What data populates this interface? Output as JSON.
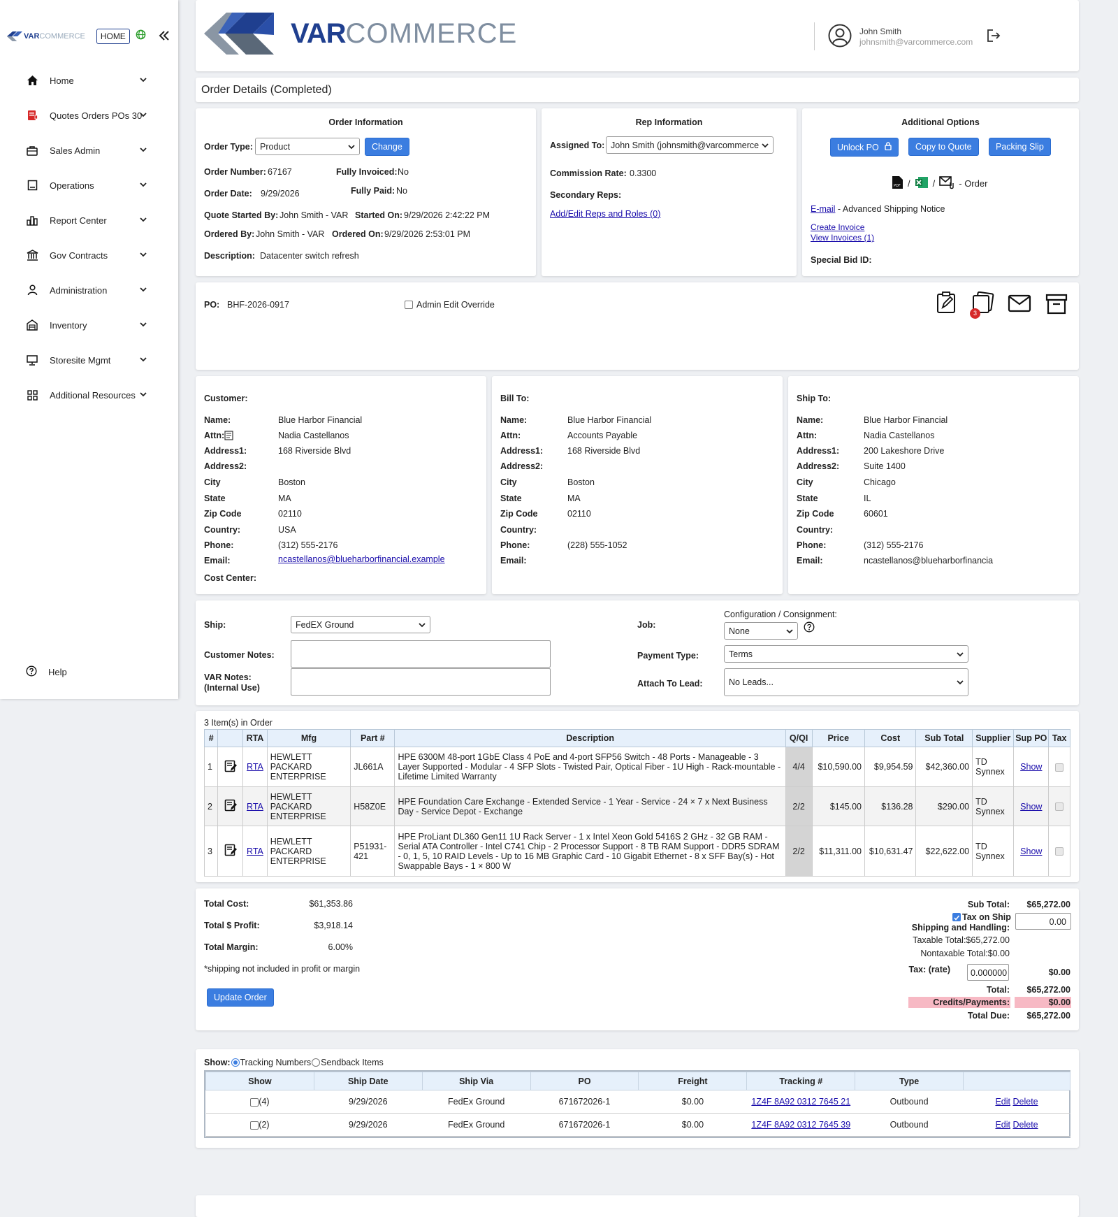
{
  "sidebar": {
    "logo_bold": "VAR",
    "logo_light": "COMMERCE",
    "home_button": "HOME",
    "items": [
      {
        "label": "Home",
        "icon": "home-icon"
      },
      {
        "label": "Quotes Orders POs 30",
        "icon": "document-red-icon"
      },
      {
        "label": "Sales Admin",
        "icon": "briefcase-icon"
      },
      {
        "label": "Operations",
        "icon": "clipboard-icon"
      },
      {
        "label": "Report Center",
        "icon": "bar-chart-icon"
      },
      {
        "label": "Gov Contracts",
        "icon": "building-icon"
      },
      {
        "label": "Administration",
        "icon": "person-icon"
      },
      {
        "label": "Inventory",
        "icon": "warehouse-icon"
      },
      {
        "label": "Storesite Mgmt",
        "icon": "monitor-icon"
      },
      {
        "label": "Additional Resources",
        "icon": "grid-icon"
      }
    ],
    "help": "Help"
  },
  "header": {
    "logo_bold": "VAR",
    "logo_light": "COMMERCE",
    "user_name": "John Smith",
    "user_email": "johnsmith@varcommerce.com"
  },
  "page_title": "Order Details (Completed)",
  "order_info": {
    "heading": "Order Information",
    "order_type_label": "Order Type:",
    "order_type_value": "Product",
    "change_button": "Change",
    "order_number_label": "Order Number:",
    "order_number": "67167",
    "fully_invoiced_label": "Fully Invoiced:",
    "fully_invoiced": "No",
    "order_date_label": "Order Date:",
    "order_date": "9/29/2026",
    "fully_paid_label": "Fully Paid:",
    "fully_paid": "No",
    "quote_started_by_label": "Quote Started By:",
    "quote_started_by": "John Smith - VAR",
    "started_on_label": "Started On:",
    "started_on": "9/29/2026 2:42:22 PM",
    "ordered_by_label": "Ordered By:",
    "ordered_by": "John Smith - VAR",
    "ordered_on_label": "Ordered On:",
    "ordered_on": "9/29/2026 2:53:01 PM",
    "description_label": "Description:",
    "description": "Datacenter switch refresh"
  },
  "rep_info": {
    "heading": "Rep Information",
    "assigned_to_label": "Assigned To:",
    "assigned_to": "John Smith (johnsmith@varcommerce",
    "commission_rate_label": "Commission Rate:",
    "commission_rate": "0.3300",
    "secondary_reps_label": "Secondary Reps:",
    "add_edit_link": "Add/Edit Reps and Roles (0)"
  },
  "additional_options": {
    "heading": "Additional Options",
    "unlock_po": "Unlock PO",
    "copy_to_quote": "Copy to Quote",
    "packing_slip": "Packing Slip",
    "order_suffix": "- Order",
    "slash": "/",
    "email_link": "E-mail",
    "advanced_shipping": "- Advanced Shipping Notice",
    "create_invoice": "Create Invoice",
    "view_invoices": "View Invoices (1)",
    "special_bid_label": "Special Bid ID:"
  },
  "po_section": {
    "po_label": "PO:",
    "po_value": "BHF-2026-0917",
    "admin_override": "Admin Edit Override",
    "notify_badge": "3"
  },
  "customer": {
    "heading": "Customer:",
    "labels": [
      "Name:",
      "Attn:",
      "Address1:",
      "Address2:",
      "City",
      "State",
      "Zip Code",
      "Country:",
      "Phone:",
      "Email:",
      "Cost Center:"
    ],
    "name": "Blue Harbor Financial",
    "attn": "Nadia Castellanos",
    "address1": "168 Riverside Blvd",
    "address2": "",
    "city": "Boston",
    "state": "MA",
    "zip": "02110",
    "country": "USA",
    "phone": "(312) 555-2176",
    "email": "ncastellanos@blueharborfinancial.example"
  },
  "bill_to": {
    "heading": "Bill To:",
    "labels": [
      "Name:",
      "Attn:",
      "Address1:",
      "Address2:",
      "City",
      "State",
      "Zip Code",
      "Country:",
      "Phone:",
      "Email:"
    ],
    "name": "Blue Harbor Financial",
    "attn": "Accounts Payable",
    "address1": "168 Riverside Blvd",
    "city": "Boston",
    "state": "MA",
    "zip": "02110",
    "phone": "(228) 555-1052"
  },
  "ship_to": {
    "heading": "Ship To:",
    "labels": [
      "Name:",
      "Attn:",
      "Address1:",
      "Address2:",
      "City",
      "State",
      "Zip Code",
      "Country:",
      "Phone:",
      "Email:"
    ],
    "name": "Blue Harbor Financial",
    "attn": "Nadia Castellanos",
    "address1": "200 Lakeshore Drive",
    "address2": "Suite 1400",
    "city": "Chicago",
    "state": "IL",
    "zip": "60601",
    "phone": "(312) 555-2176",
    "email": "ncastellanos@blueharborfinancia"
  },
  "shipping_form": {
    "ship_label": "Ship:",
    "ship_value": "FedEX Ground",
    "customer_notes_label": "Customer Notes:",
    "var_notes_label_1": "VAR Notes:",
    "var_notes_label_2": "(Internal Use)",
    "job_label": "Job:",
    "config_label": "Configuration / Consignment:",
    "config_value": "None",
    "payment_type_label": "Payment Type:",
    "payment_type_value": "Terms",
    "attach_lead_label": "Attach To Lead:",
    "attach_lead_value": "No Leads..."
  },
  "items": {
    "count_text": "3 Item(s) in Order",
    "headers": [
      "#",
      "",
      "RTA",
      "Mfg",
      "Part #",
      "Description",
      "Q/QI",
      "Price",
      "Cost",
      "Sub Total",
      "Supplier",
      "Sup PO",
      "Tax"
    ],
    "rows": [
      {
        "n": "1",
        "rta": "RTA",
        "mfg": "HEWLETT PACKARD ENTERPRISE",
        "part": "JL661A",
        "desc": "HPE 6300M 48-port 1GbE Class 4 PoE and 4-port SFP56 Switch - 48 Ports - Manageable - 3 Layer Supported - Modular - 4 SFP Slots - Twisted Pair, Optical Fiber - 1U High - Rack-mountable - Lifetime Limited Warranty",
        "qty": "4/4",
        "price": "$10,590.00",
        "cost": "$9,954.59",
        "subtotal": "$42,360.00",
        "supplier": "TD Synnex",
        "sup_po": "Show"
      },
      {
        "n": "2",
        "rta": "RTA",
        "mfg": "HEWLETT PACKARD ENTERPRISE",
        "part": "H58Z0E",
        "desc": "HPE Foundation Care Exchange - Extended Service - 1 Year - Service - 24 × 7 x Next Business Day - Service Depot - Exchange",
        "qty": "2/2",
        "price": "$145.00",
        "cost": "$136.28",
        "subtotal": "$290.00",
        "supplier": "TD Synnex",
        "sup_po": "Show"
      },
      {
        "n": "3",
        "rta": "RTA",
        "mfg": "HEWLETT PACKARD ENTERPRISE",
        "part": "P51931-421",
        "desc": "HPE ProLiant DL360 Gen11 1U Rack Server - 1 x Intel Xeon Gold 5416S 2 GHz - 32 GB RAM - Serial ATA Controller - Intel C741 Chip - 2 Processor Support - 8 TB RAM Support - DDR5 SDRAM - 0, 1, 5, 10 RAID Levels - Up to 16 MB Graphic Card - 10 Gigabit Ethernet - 8 x SFF Bay(s) - Hot Swappable Bays - 1 × 800 W",
        "qty": "2/2",
        "price": "$11,311.00",
        "cost": "$10,631.47",
        "subtotal": "$22,622.00",
        "supplier": "TD Synnex",
        "sup_po": "Show"
      }
    ]
  },
  "totals": {
    "total_cost_label": "Total Cost:",
    "total_cost": "$61,353.86",
    "total_profit_label": "Total $ Profit:",
    "total_profit": "$3,918.14",
    "total_margin_label": "Total Margin:",
    "total_margin": "6.00%",
    "note": "*shipping not included in profit or margin",
    "update_button": "Update Order",
    "subtotal_label": "Sub Total:",
    "subtotal": "$65,272.00",
    "tax_on_ship": "Tax on Ship",
    "shipping_label": "Shipping and Handling:",
    "shipping_value": "0.00",
    "taxable_total": "Taxable Total:$65,272.00",
    "nontaxable_total": "Nontaxable Total:$0.00",
    "tax_rate_label": "Tax: (rate)",
    "tax_rate_value": "0.000000",
    "tax_amount": "$0.00",
    "total_label": "Total:",
    "total": "$65,272.00",
    "credits_label": "Credits/Payments:",
    "credits": "$0.00",
    "total_due_label": "Total Due:",
    "total_due": "$65,272.00"
  },
  "tracking": {
    "show_label": "Show:",
    "option_tracking": "Tracking Numbers",
    "option_sendback": "Sendback Items",
    "headers": [
      "Show",
      "Ship Date",
      "Ship Via",
      "PO",
      "Freight",
      "Tracking #",
      "Type",
      ""
    ],
    "rows": [
      {
        "count": "(4)",
        "date": "9/29/2026",
        "via": "FedEx Ground",
        "po": "671672026-1",
        "freight": "$0.00",
        "tracking": "1Z4F 8A92 0312 7645 21",
        "type": "Outbound",
        "edit": "Edit",
        "delete": "Delete"
      },
      {
        "count": "(2)",
        "date": "9/29/2026",
        "via": "FedEx Ground",
        "po": "671672026-1",
        "freight": "$0.00",
        "tracking": "1Z4F 8A92 0312 7645 39",
        "type": "Outbound",
        "edit": "Edit",
        "delete": "Delete"
      }
    ]
  },
  "colors": {
    "accent": "#3b7de0",
    "brand": "#1f3f8f",
    "credits_bg": "#f7b9c4"
  }
}
